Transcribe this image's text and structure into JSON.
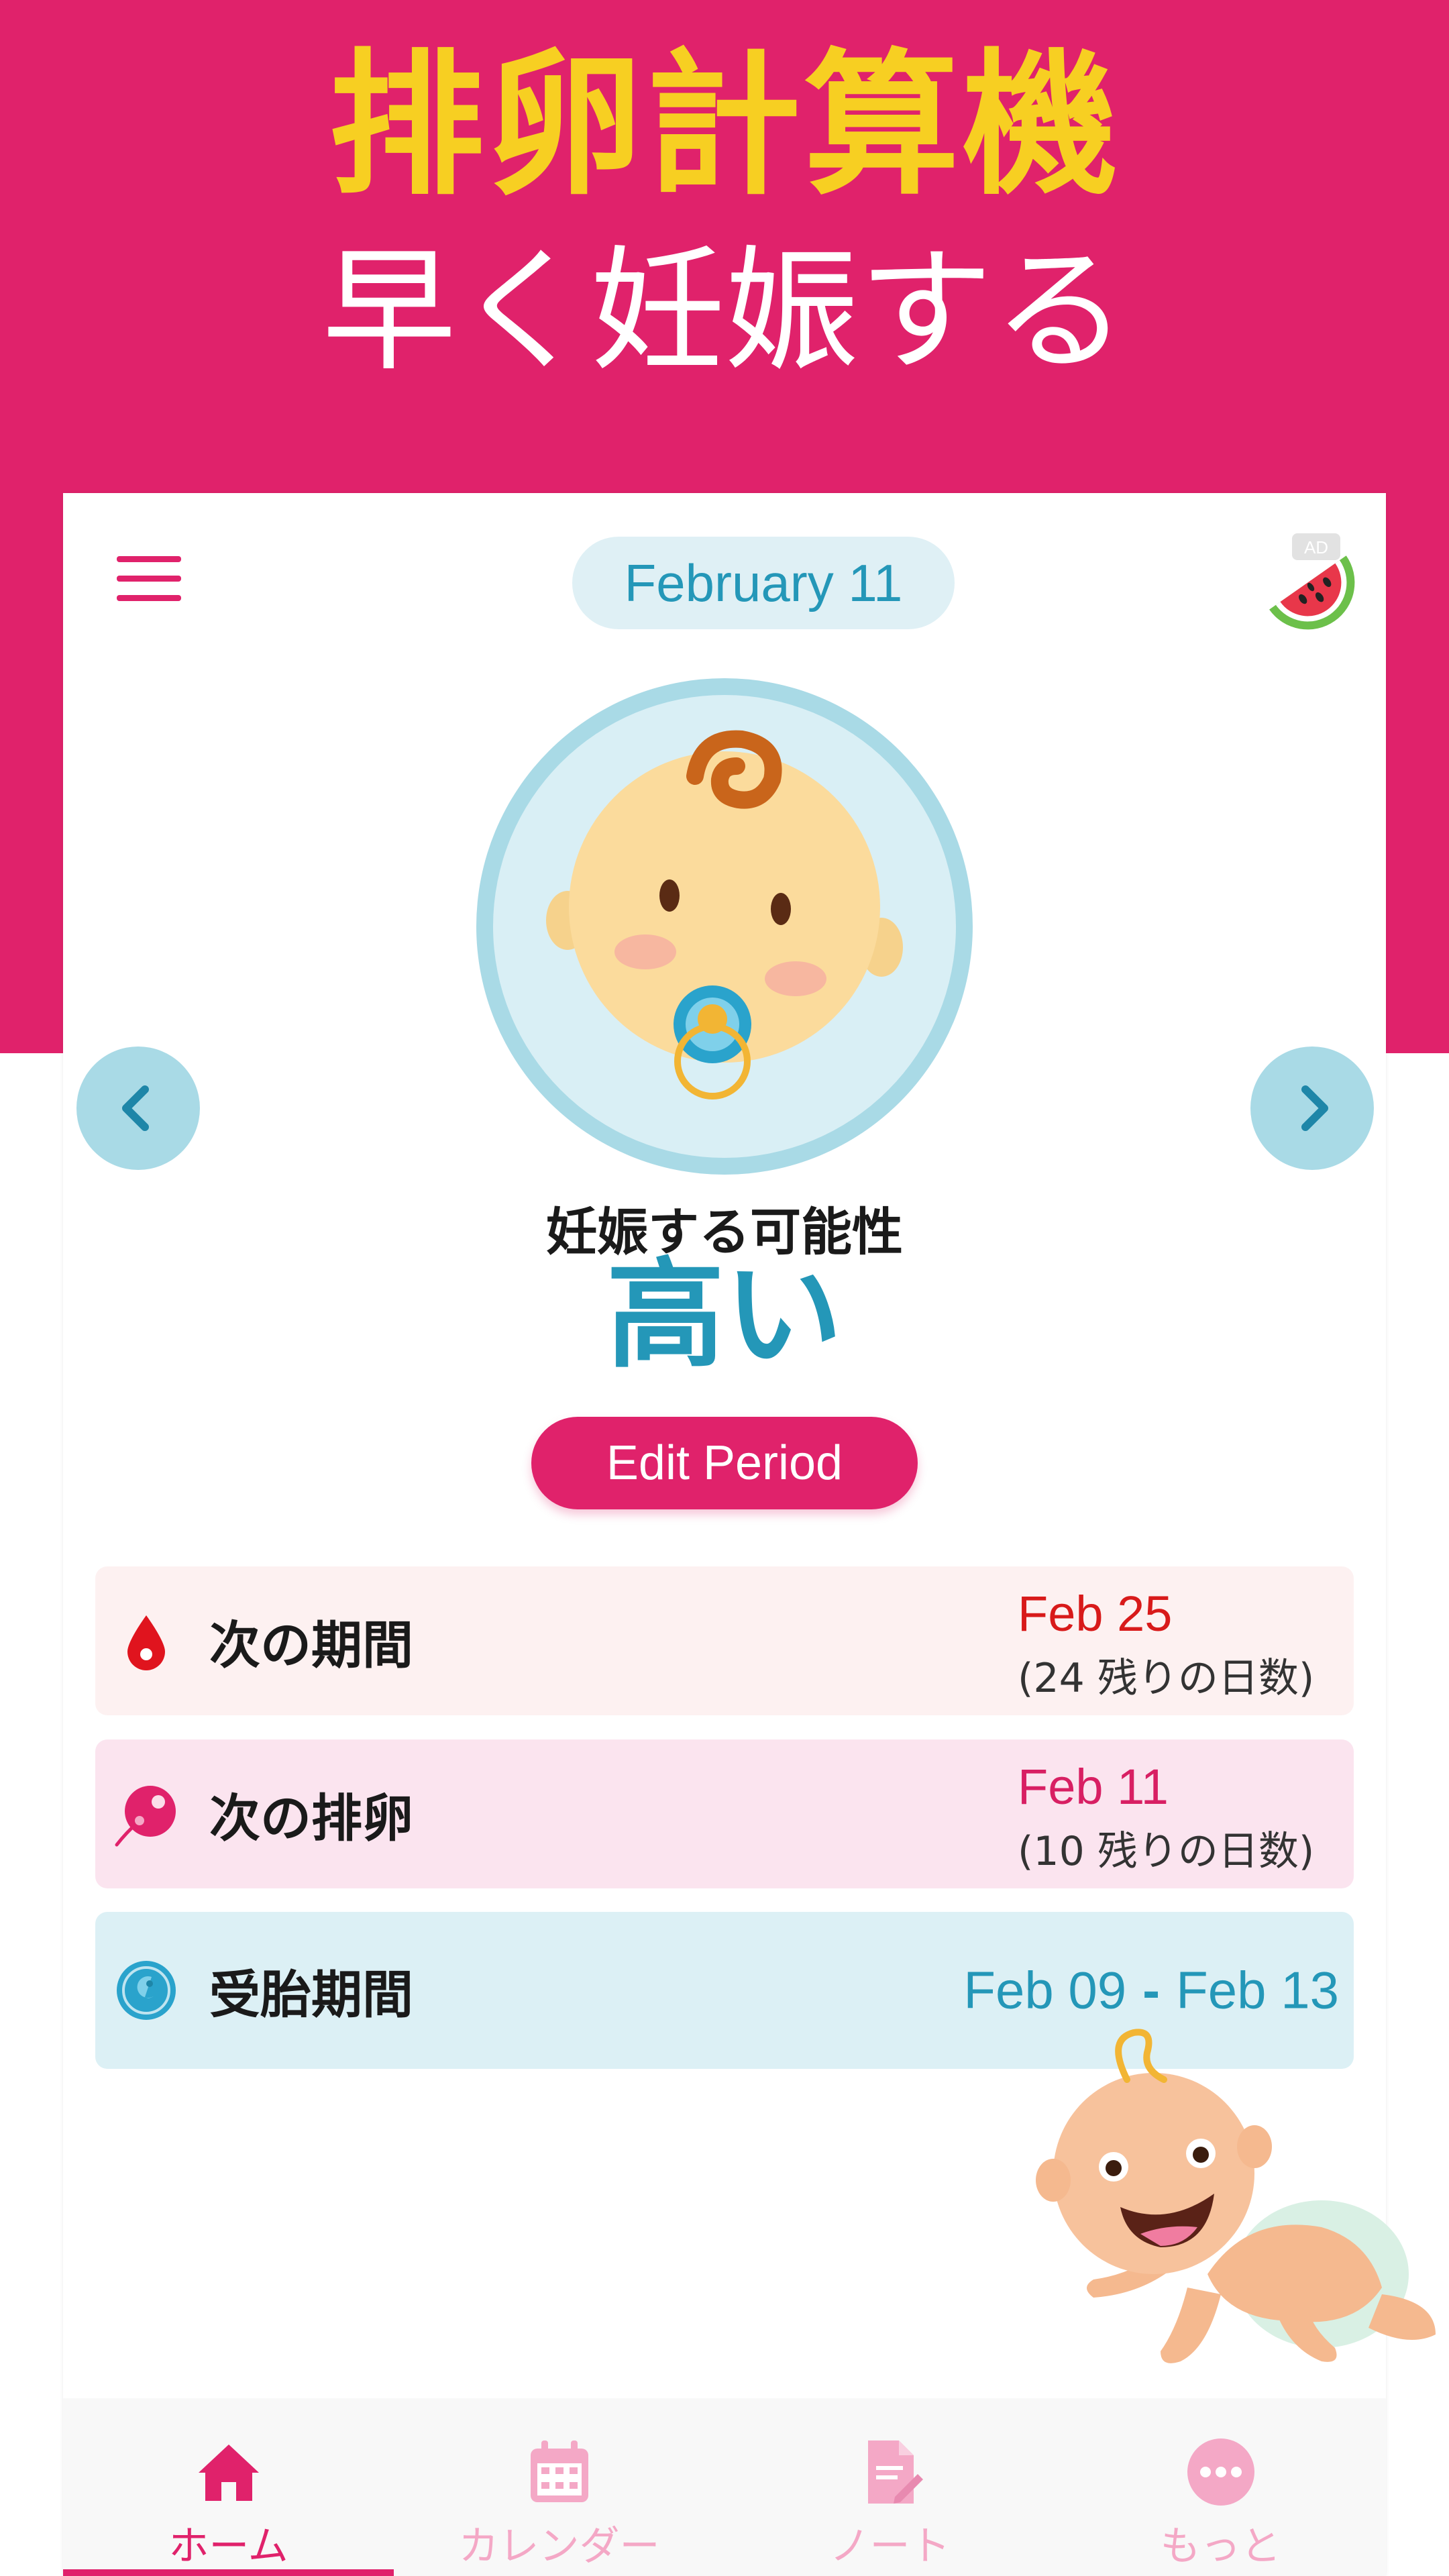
{
  "promo": {
    "title": "排卵計算機",
    "subtitle": "早く妊娠する"
  },
  "header": {
    "date": "February  11",
    "ad_label": "AD"
  },
  "status": {
    "chance_label": "妊娠する可能性",
    "chance_value": "高い"
  },
  "actions": {
    "edit_period_label": "Edit Period"
  },
  "cards": [
    {
      "label": "次の期間",
      "date": "Feb 25",
      "days": "(24 残りの日数)",
      "icon": "blood-drop-icon"
    },
    {
      "label": "次の排卵",
      "date": "Feb 11",
      "days": "(10 残りの日数)",
      "icon": "egg-cell-icon"
    },
    {
      "label": "受胎期間",
      "range_start": "Feb 09",
      "range_sep": "-",
      "range_end": "Feb 13",
      "icon": "embryo-icon"
    }
  ],
  "tabs": [
    {
      "label": "ホーム",
      "icon": "home-icon",
      "active": true
    },
    {
      "label": "カレンダー",
      "icon": "calendar-icon",
      "active": false
    },
    {
      "label": "ノート",
      "icon": "note-icon",
      "active": false
    },
    {
      "label": "もっと",
      "icon": "more-icon",
      "active": false
    }
  ],
  "colors": {
    "brand_pink": "#e0226b",
    "title_yellow": "#f7cf22",
    "accent_blue": "#2497b8",
    "period_red": "#d81a1a"
  }
}
